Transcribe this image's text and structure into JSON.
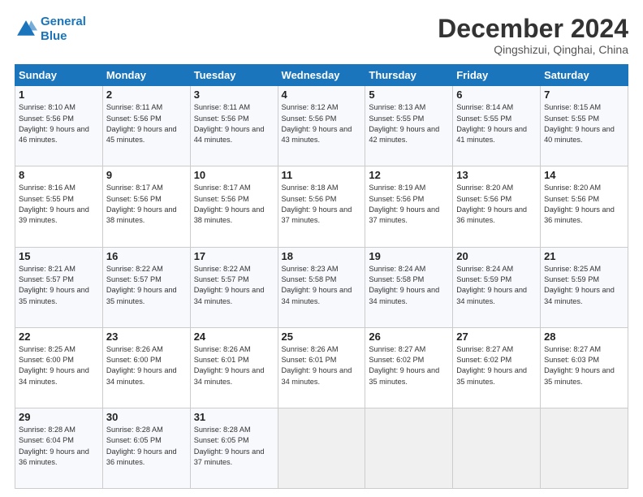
{
  "logo": {
    "line1": "General",
    "line2": "Blue"
  },
  "title": "December 2024",
  "subtitle": "Qingshizui, Qinghai, China",
  "days": [
    "Sunday",
    "Monday",
    "Tuesday",
    "Wednesday",
    "Thursday",
    "Friday",
    "Saturday"
  ],
  "weeks": [
    [
      {
        "day": "1",
        "sunrise": "8:10 AM",
        "sunset": "5:56 PM",
        "daylight": "9 hours and 46 minutes."
      },
      {
        "day": "2",
        "sunrise": "8:11 AM",
        "sunset": "5:56 PM",
        "daylight": "9 hours and 45 minutes."
      },
      {
        "day": "3",
        "sunrise": "8:11 AM",
        "sunset": "5:56 PM",
        "daylight": "9 hours and 44 minutes."
      },
      {
        "day": "4",
        "sunrise": "8:12 AM",
        "sunset": "5:56 PM",
        "daylight": "9 hours and 43 minutes."
      },
      {
        "day": "5",
        "sunrise": "8:13 AM",
        "sunset": "5:55 PM",
        "daylight": "9 hours and 42 minutes."
      },
      {
        "day": "6",
        "sunrise": "8:14 AM",
        "sunset": "5:55 PM",
        "daylight": "9 hours and 41 minutes."
      },
      {
        "day": "7",
        "sunrise": "8:15 AM",
        "sunset": "5:55 PM",
        "daylight": "9 hours and 40 minutes."
      }
    ],
    [
      {
        "day": "8",
        "sunrise": "8:16 AM",
        "sunset": "5:55 PM",
        "daylight": "9 hours and 39 minutes."
      },
      {
        "day": "9",
        "sunrise": "8:17 AM",
        "sunset": "5:56 PM",
        "daylight": "9 hours and 38 minutes."
      },
      {
        "day": "10",
        "sunrise": "8:17 AM",
        "sunset": "5:56 PM",
        "daylight": "9 hours and 38 minutes."
      },
      {
        "day": "11",
        "sunrise": "8:18 AM",
        "sunset": "5:56 PM",
        "daylight": "9 hours and 37 minutes."
      },
      {
        "day": "12",
        "sunrise": "8:19 AM",
        "sunset": "5:56 PM",
        "daylight": "9 hours and 37 minutes."
      },
      {
        "day": "13",
        "sunrise": "8:20 AM",
        "sunset": "5:56 PM",
        "daylight": "9 hours and 36 minutes."
      },
      {
        "day": "14",
        "sunrise": "8:20 AM",
        "sunset": "5:56 PM",
        "daylight": "9 hours and 36 minutes."
      }
    ],
    [
      {
        "day": "15",
        "sunrise": "8:21 AM",
        "sunset": "5:57 PM",
        "daylight": "9 hours and 35 minutes."
      },
      {
        "day": "16",
        "sunrise": "8:22 AM",
        "sunset": "5:57 PM",
        "daylight": "9 hours and 35 minutes."
      },
      {
        "day": "17",
        "sunrise": "8:22 AM",
        "sunset": "5:57 PM",
        "daylight": "9 hours and 34 minutes."
      },
      {
        "day": "18",
        "sunrise": "8:23 AM",
        "sunset": "5:58 PM",
        "daylight": "9 hours and 34 minutes."
      },
      {
        "day": "19",
        "sunrise": "8:24 AM",
        "sunset": "5:58 PM",
        "daylight": "9 hours and 34 minutes."
      },
      {
        "day": "20",
        "sunrise": "8:24 AM",
        "sunset": "5:59 PM",
        "daylight": "9 hours and 34 minutes."
      },
      {
        "day": "21",
        "sunrise": "8:25 AM",
        "sunset": "5:59 PM",
        "daylight": "9 hours and 34 minutes."
      }
    ],
    [
      {
        "day": "22",
        "sunrise": "8:25 AM",
        "sunset": "6:00 PM",
        "daylight": "9 hours and 34 minutes."
      },
      {
        "day": "23",
        "sunrise": "8:26 AM",
        "sunset": "6:00 PM",
        "daylight": "9 hours and 34 minutes."
      },
      {
        "day": "24",
        "sunrise": "8:26 AM",
        "sunset": "6:01 PM",
        "daylight": "9 hours and 34 minutes."
      },
      {
        "day": "25",
        "sunrise": "8:26 AM",
        "sunset": "6:01 PM",
        "daylight": "9 hours and 34 minutes."
      },
      {
        "day": "26",
        "sunrise": "8:27 AM",
        "sunset": "6:02 PM",
        "daylight": "9 hours and 35 minutes."
      },
      {
        "day": "27",
        "sunrise": "8:27 AM",
        "sunset": "6:02 PM",
        "daylight": "9 hours and 35 minutes."
      },
      {
        "day": "28",
        "sunrise": "8:27 AM",
        "sunset": "6:03 PM",
        "daylight": "9 hours and 35 minutes."
      }
    ],
    [
      {
        "day": "29",
        "sunrise": "8:28 AM",
        "sunset": "6:04 PM",
        "daylight": "9 hours and 36 minutes."
      },
      {
        "day": "30",
        "sunrise": "8:28 AM",
        "sunset": "6:05 PM",
        "daylight": "9 hours and 36 minutes."
      },
      {
        "day": "31",
        "sunrise": "8:28 AM",
        "sunset": "6:05 PM",
        "daylight": "9 hours and 37 minutes."
      },
      null,
      null,
      null,
      null
    ]
  ]
}
